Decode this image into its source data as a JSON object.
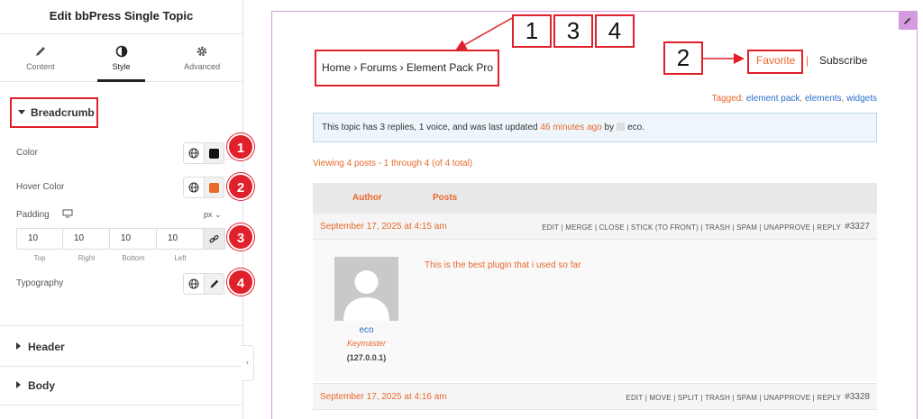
{
  "panel": {
    "title": "Edit bbPress Single Topic",
    "tabs": [
      {
        "label": "Content",
        "icon": "pencil-icon"
      },
      {
        "label": "Style",
        "icon": "contrast-icon"
      },
      {
        "label": "Advanced",
        "icon": "gear-icon"
      }
    ],
    "active_tab": "Style",
    "section": "Breadcrumb",
    "controls": {
      "color_label": "Color",
      "color_value": "#111111",
      "hover_color_label": "Hover Color",
      "hover_color_value": "#e8692a",
      "padding_label": "Padding",
      "padding_unit": "px",
      "padding_values": [
        "10",
        "10",
        "10",
        "10"
      ],
      "padding_captions": [
        "Top",
        "Right",
        "Bottom",
        "Left"
      ],
      "typography_label": "Typography"
    },
    "collapsed_sections": [
      "Header",
      "Body"
    ]
  },
  "badges": [
    "1",
    "2",
    "3",
    "4"
  ],
  "preview": {
    "breadcrumb": "Home › Forums › Element Pack Pro",
    "callout_numbers": [
      "1",
      "3",
      "4"
    ],
    "callout_fav_number": "2",
    "favorite": "Favorite",
    "separator": "|",
    "subscribe": "Subscribe",
    "tagged_label": "Tagged:",
    "tags": [
      "element pack",
      "elements",
      "widgets"
    ],
    "notice": {
      "before": "This topic has 3 replies, 1 voice, and was last updated",
      "time": "46 minutes ago",
      "by": "by",
      "user": "eco."
    },
    "viewing": "Viewing 4 posts - 1 through 4 (of 4 total)",
    "header_author": "Author",
    "header_posts": "Posts",
    "posts": [
      {
        "date": "September 17, 2025 at 4:15 am",
        "actions": "EDIT | MERGE | CLOSE | STICK (TO FRONT) | TRASH | SPAM | UNAPPROVE | REPLY",
        "id": "#3327",
        "author": "eco",
        "role": "Keymaster",
        "ip": "(127.0.0.1)",
        "content": "This is the best plugin that i used so far"
      },
      {
        "date": "September 17, 2025 at 4:16 am",
        "actions": "EDIT | MOVE | SPLIT | TRASH | SPAM | UNAPPROVE | REPLY",
        "id": "#3328"
      }
    ]
  },
  "colors": {
    "accent_red": "#e0202a",
    "link_orange": "#e8692a",
    "link_blue": "#2a6fc9",
    "selection_purple": "#d59be0"
  }
}
